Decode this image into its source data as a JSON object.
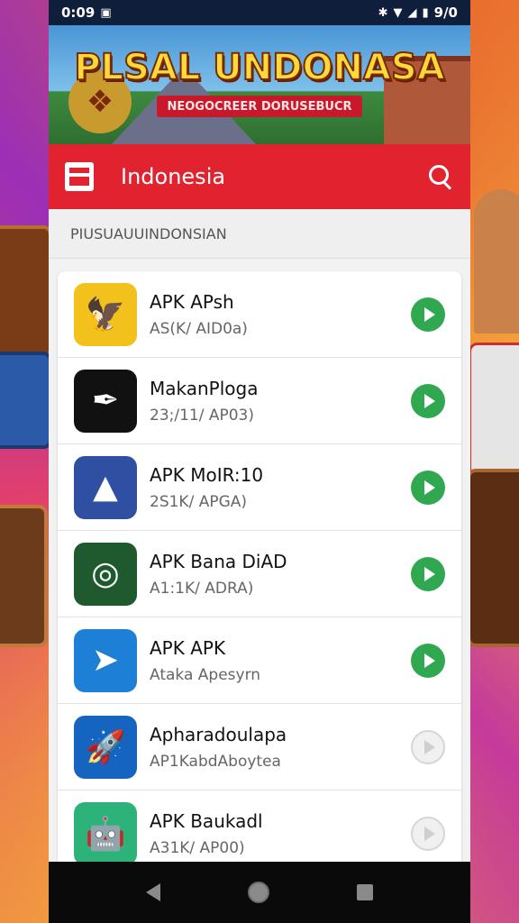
{
  "status_bar": {
    "time": "0:09",
    "left_badge": "▣",
    "battery_text": "9/0",
    "icons": [
      "bluetooth-icon",
      "wifi-icon",
      "signal-icon",
      "battery-icon"
    ]
  },
  "banner": {
    "title": "PLSAL UNDONASA",
    "subtitle": "NEOGOCREER DORUSEBUCR"
  },
  "app_bar": {
    "title": "Indonesia",
    "accent_color": "#e0232f"
  },
  "section": {
    "header": "PIUSUAUUINDONSIAN"
  },
  "apps": [
    {
      "name": "APK APsh",
      "sub": "AS(K/ AID0a)",
      "icon": "garuda-icon",
      "icon_bg": "#f2c11b",
      "icon_glyph": "🦅",
      "enabled": true
    },
    {
      "name": "MakanPloga",
      "sub": "23;/11/ AP03)",
      "icon": "compass-logo-icon",
      "icon_bg": "#111111",
      "icon_glyph": "✒",
      "enabled": true
    },
    {
      "name": "APK MoIR:10",
      "sub": "2S1K/ APGA)",
      "icon": "arrow-logo-icon",
      "icon_bg": "#2f4fa3",
      "icon_glyph": "▲",
      "enabled": true
    },
    {
      "name": "APK Bana DiAD",
      "sub": "A1:1K/ ADRA)",
      "icon": "globe-logo-icon",
      "icon_bg": "#1f5a2e",
      "icon_glyph": "◎",
      "enabled": true
    },
    {
      "name": "APK APK",
      "sub": "Ataka Apesyrn",
      "icon": "navigation-arrow-icon",
      "icon_bg": "#1d7fd6",
      "icon_glyph": "➤",
      "enabled": true
    },
    {
      "name": "Apharadoulapa",
      "sub": "AP1KabdAboytea",
      "icon": "rocket-icon",
      "icon_bg": "#1565c0",
      "icon_glyph": "🚀",
      "enabled": false
    },
    {
      "name": "APK Baukadl",
      "sub": "A31K/ AP00)",
      "icon": "robot-icon",
      "icon_bg": "#2db37a",
      "icon_glyph": "🤖",
      "enabled": false
    }
  ],
  "nav_bar": {
    "buttons": [
      "back-icon",
      "home-icon",
      "recent-apps-icon"
    ]
  }
}
